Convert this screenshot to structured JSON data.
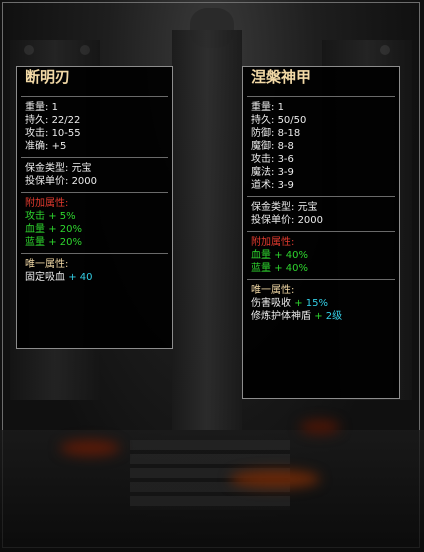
{
  "left_item": {
    "name": "断明刃",
    "stats": [
      {
        "label": "重量:",
        "value": "1"
      },
      {
        "label": "持久:",
        "value": "22/22"
      },
      {
        "label": "攻击:",
        "value": "10-55"
      },
      {
        "label": "准确:",
        "value": "+5"
      }
    ],
    "insurance": [
      {
        "label": "保金类型:",
        "value": "元宝"
      },
      {
        "label": "投保单价:",
        "value": "2000"
      }
    ],
    "extra_header": "附加属性:",
    "extras": [
      {
        "label": "攻击",
        "value": "+ 5%"
      },
      {
        "label": "血量",
        "value": "+ 20%"
      },
      {
        "label": "蓝量",
        "value": "+ 20%"
      }
    ],
    "unique_header": "唯一属性:",
    "uniques": [
      {
        "label": "固定吸血",
        "value": "+ 40"
      }
    ]
  },
  "right_item": {
    "name": "涅槃神甲",
    "stats": [
      {
        "label": "重量:",
        "value": "1"
      },
      {
        "label": "持久:",
        "value": "50/50"
      },
      {
        "label": "防御:",
        "value": "8-18"
      },
      {
        "label": "魔御:",
        "value": "8-8"
      },
      {
        "label": "攻击:",
        "value": "3-6"
      },
      {
        "label": "魔法:",
        "value": "3-9"
      },
      {
        "label": "道术:",
        "value": "3-9"
      }
    ],
    "insurance": [
      {
        "label": "保金类型:",
        "value": "元宝"
      },
      {
        "label": "投保单价:",
        "value": "2000"
      }
    ],
    "extra_header": "附加属性:",
    "extras": [
      {
        "label": "血量",
        "value": "+ 40%"
      },
      {
        "label": "蓝量",
        "value": "+ 40%"
      }
    ],
    "unique_header": "唯一属性:",
    "uniques": [
      {
        "label": "伤害吸收",
        "plus": "+",
        "value": "15%"
      },
      {
        "label": "修炼护体神盾",
        "plus": "+",
        "value": "2级"
      }
    ]
  },
  "colors": {
    "title": "#f2d9a6",
    "extra_header": "#e23a2e",
    "green_attr": "#2ed52e",
    "cyan_value": "#34cfe6"
  }
}
